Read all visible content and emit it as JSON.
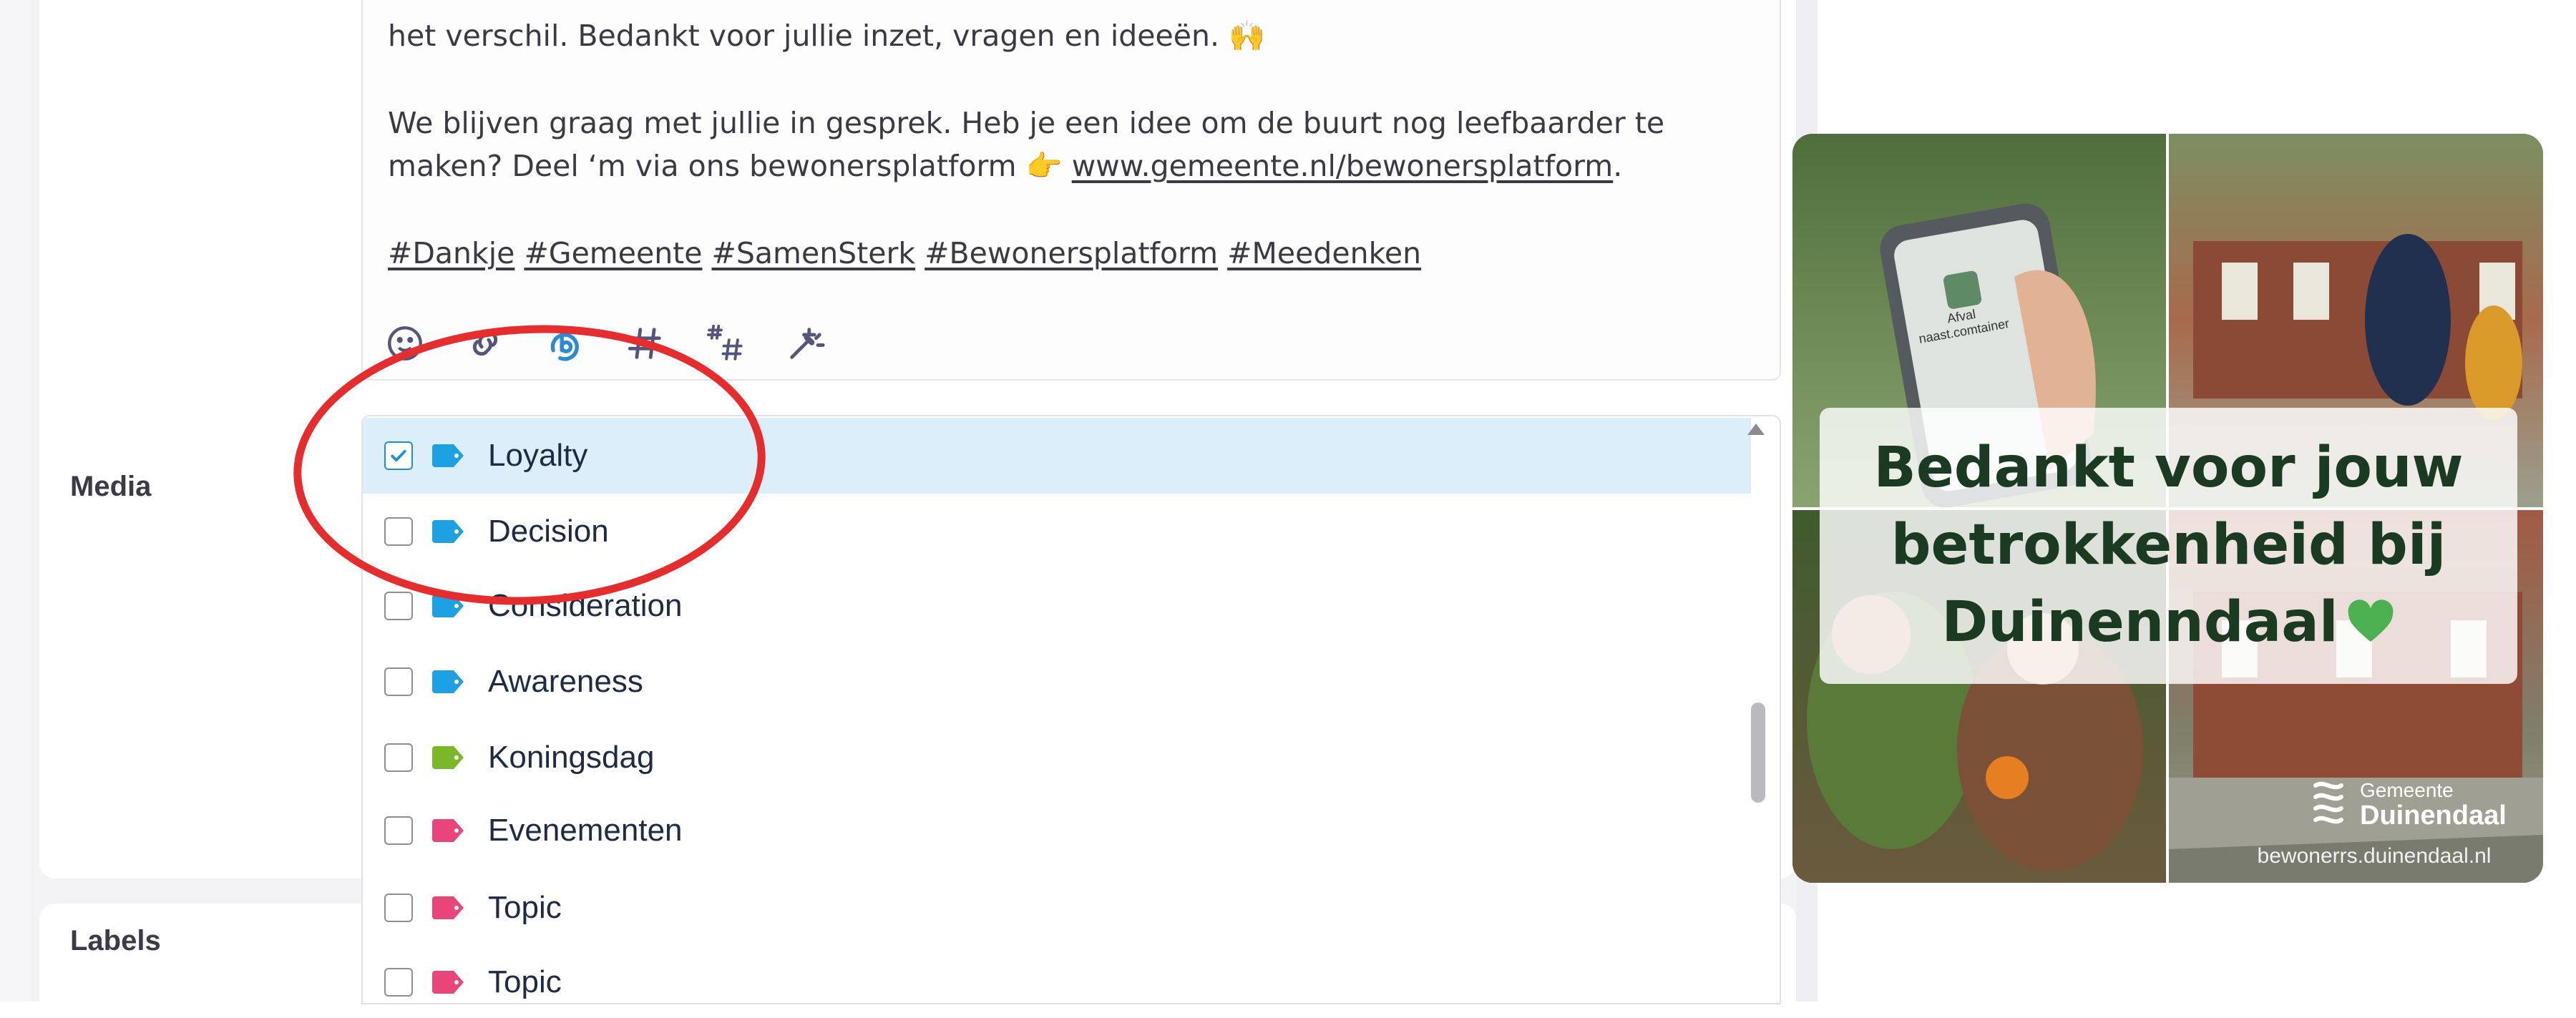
{
  "form": {
    "media_label": "Media",
    "labels_label": "Labels"
  },
  "editor": {
    "line1": "het verschil. Bedankt voor jullie inzet, vragen en ideeën. 🙌",
    "para2_text": "We blijven graag met jullie in gesprek. Heb je een idee om de buurt nog leefbaarder te maken? Deel ‘m via ons bewonersplatform 👉 ",
    "link": "www.gemeente.nl/bewonersplatform",
    "link_suffix": ".",
    "hashtags": [
      "#Dankje",
      "#Gemeente",
      "#SamenSterk",
      "#Bewonersplatform",
      "#Meedenken"
    ]
  },
  "toolbar_icons": [
    "emoji-icon",
    "link-icon",
    "bitly-icon",
    "hashtag-icon",
    "hashtag-suggest-icon",
    "magic-wand-icon"
  ],
  "label_options": [
    {
      "label": "Loyalty",
      "checked": true,
      "color": "#1da1e2"
    },
    {
      "label": "Decision",
      "checked": false,
      "color": "#1da1e2"
    },
    {
      "label": "Consideration",
      "checked": false,
      "color": "#1da1e2"
    },
    {
      "label": "Awareness",
      "checked": false,
      "color": "#1da1e2"
    },
    {
      "label": "Koningsdag",
      "checked": false,
      "color": "#7ab829"
    },
    {
      "label": "Evenementen",
      "checked": false,
      "color": "#e8457a"
    },
    {
      "label": "Topic",
      "checked": false,
      "color": "#e8457a"
    },
    {
      "label": "Topic",
      "checked": false,
      "color": "#e8457a"
    }
  ],
  "poster": {
    "phone_text": "Afval naast.comtainer",
    "headline_line1": "Bedankt voor jouw",
    "headline_line2": "betrokkenheid bij",
    "headline_line3": "Duinenndaal",
    "heart_color": "#4caf50",
    "logo_small": "Gemeente",
    "logo_big": "Duinendaal",
    "url": "bewonerrs.duinendaal.nl"
  },
  "colors": {
    "accent_blue": "#1da1e2",
    "annotation_red": "#e52d2d",
    "selected_row": "#ddeefb"
  }
}
